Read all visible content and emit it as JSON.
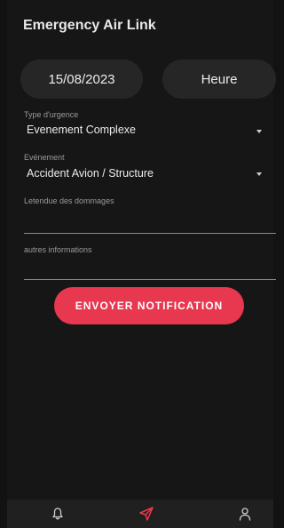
{
  "app": {
    "title": "Emergency Air Link"
  },
  "datetime": {
    "date": "15/08/2023",
    "time_label": "Heure"
  },
  "form": {
    "type_urgence": {
      "label": "Type d'urgence",
      "value": "Evenement Complexe"
    },
    "evenement": {
      "label": "Evénement",
      "value": "Accident Avion / Structure"
    },
    "etendue": {
      "label": "Letendue des dommages",
      "value": ""
    },
    "autres": {
      "label": "autres informations",
      "value": ""
    }
  },
  "actions": {
    "send_label": "ENVOYER NOTIFICATION"
  },
  "nav": {
    "items": [
      {
        "icon": "bell-icon"
      },
      {
        "icon": "send-icon"
      },
      {
        "icon": "user-icon"
      }
    ]
  },
  "colors": {
    "accent": "#E8384F",
    "background": "#161616",
    "surface": "#262626"
  }
}
